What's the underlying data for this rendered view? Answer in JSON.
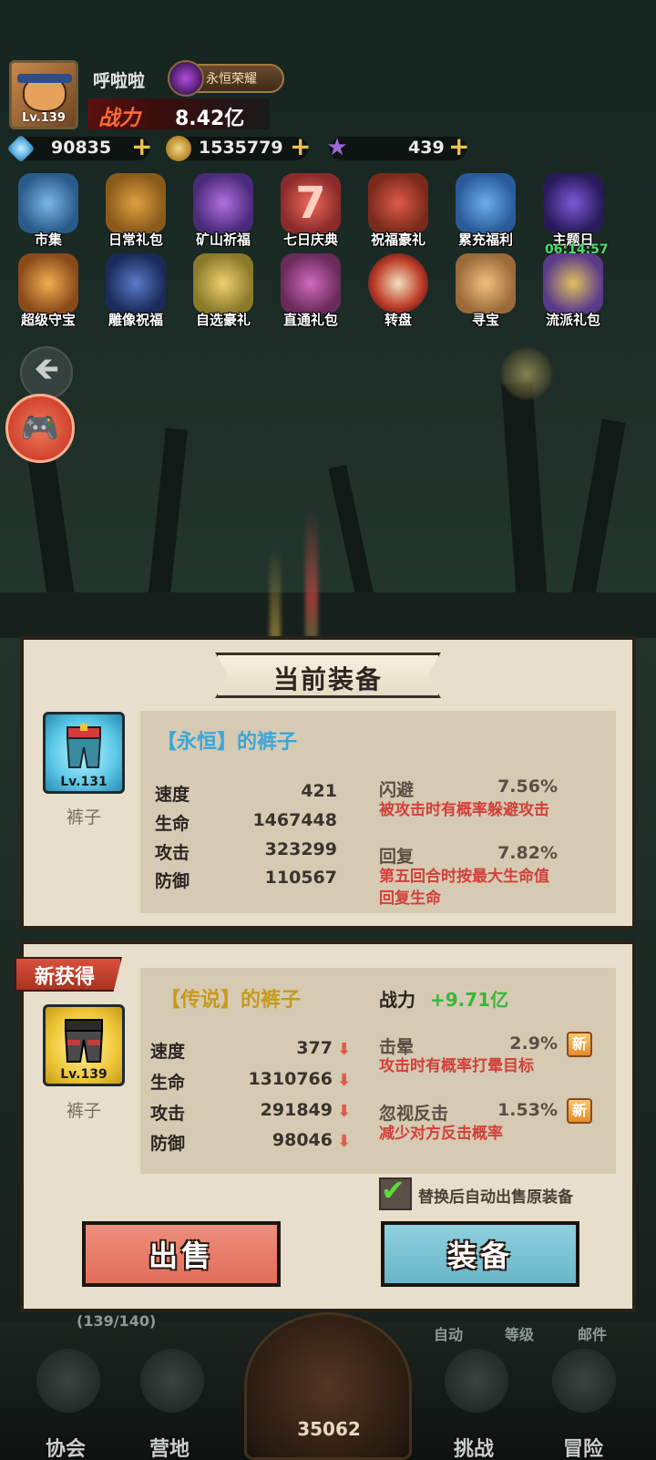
{
  "header": {
    "player_name": "呼啦啦",
    "honor_title": "永恒荣耀",
    "avatar_level": "Lv.139",
    "power_label": "战力",
    "power_value": "8.42亿",
    "resources": [
      {
        "name": "diamond",
        "icon": "diamond-icon",
        "value": "90835"
      },
      {
        "name": "coin",
        "icon": "coin-icon",
        "value": "1535779"
      },
      {
        "name": "star",
        "icon": "star-icon",
        "value": "439"
      }
    ]
  },
  "activities_row1": [
    {
      "label": "市集",
      "icon": "market-icon"
    },
    {
      "label": "日常礼包",
      "icon": "daily-pack-icon"
    },
    {
      "label": "矿山祈福",
      "icon": "mine-blessing-icon"
    },
    {
      "label": "七日庆典",
      "icon": "seven-day-icon"
    },
    {
      "label": "祝福豪礼",
      "icon": "blessing-gift-icon"
    },
    {
      "label": "累充福利",
      "icon": "recharge-welfare-icon"
    },
    {
      "label": "主题日",
      "icon": "theme-day-icon"
    }
  ],
  "activities_row2": [
    {
      "label": "超级守宝",
      "icon": "super-treasure-icon"
    },
    {
      "label": "雕像祝福",
      "icon": "statue-blessing-icon"
    },
    {
      "label": "自选豪礼",
      "icon": "optional-gift-icon"
    },
    {
      "label": "直通礼包",
      "icon": "direct-pack-icon"
    },
    {
      "label": "转盘",
      "icon": "wheel-icon"
    },
    {
      "label": "寻宝",
      "icon": "treasure-hunt-icon"
    },
    {
      "label": "流派礼包",
      "icon": "faction-pack-icon"
    }
  ],
  "theme_day_timer": "06:14:57",
  "current_equipment": {
    "title": "当前装备",
    "item_name": "【永恒】的裤子",
    "item_level": "Lv.131",
    "item_caption": "裤子",
    "stats": [
      {
        "label": "速度",
        "value": "421"
      },
      {
        "label": "生命",
        "value": "1467448"
      },
      {
        "label": "攻击",
        "value": "323299"
      },
      {
        "label": "防御",
        "value": "110567"
      }
    ],
    "bonuses": [
      {
        "name": "闪避",
        "value": "7.56%",
        "desc": "被攻击时有概率躲避攻击"
      },
      {
        "name": "回复",
        "value": "7.82%",
        "desc_line1": "第五回合时按最大生命值",
        "desc_line2": "回复生命"
      }
    ]
  },
  "new_equipment": {
    "ribbon": "新获得",
    "item_name": "【传说】的裤子",
    "item_level": "Lv.139",
    "item_caption": "裤子",
    "combat_label": "战力",
    "combat_delta": "+9.71亿",
    "stats": [
      {
        "label": "速度",
        "value": "377"
      },
      {
        "label": "生命",
        "value": "1310766"
      },
      {
        "label": "攻击",
        "value": "291849"
      },
      {
        "label": "防御",
        "value": "98046"
      }
    ],
    "bonuses": [
      {
        "name": "击晕",
        "value": "2.9%",
        "tag": "新",
        "desc": "攻击时有概率打晕目标"
      },
      {
        "name": "忽视反击",
        "value": "1.53%",
        "tag": "新",
        "desc": "减少对方反击概率"
      }
    ],
    "auto_sell_label": "替换后自动出售原装备",
    "auto_sell_checked": true
  },
  "buttons": {
    "sell": "出售",
    "equip": "装备"
  },
  "bottom": {
    "bag_count": "(139/140)",
    "sub_actions": [
      "自动",
      "等级",
      "邮件"
    ],
    "center_value": "35062",
    "nav": [
      "协会",
      "营地",
      "挑战",
      "冒险"
    ]
  },
  "colors": {
    "accent_red": "#d2403a",
    "gain_green": "#3ab53a",
    "eternal_blue": "#3aa6d8",
    "legend_gold": "#c79a1a"
  }
}
